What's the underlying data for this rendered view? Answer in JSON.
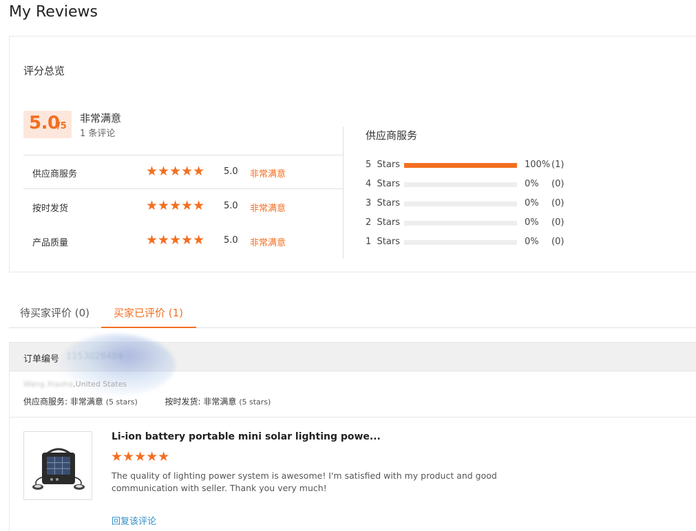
{
  "page": {
    "title": "My Reviews"
  },
  "summary": {
    "heading": "评分总览",
    "score": "5.0",
    "score_denominator": "/5",
    "overall_label": "非常满意",
    "review_count": "1 条评论",
    "dimensions": [
      {
        "name": "供应商服务",
        "stars": "★★★★★",
        "score": "5.0",
        "label": "非常满意"
      },
      {
        "name": "按时发货",
        "stars": "★★★★★",
        "score": "5.0",
        "label": "非常满意"
      },
      {
        "name": "产品质量",
        "stars": "★★★★★",
        "score": "5.0",
        "label": "非常满意"
      }
    ],
    "distribution": {
      "title": "供应商服务",
      "rows": [
        {
          "label": "5  Stars",
          "fill": 1.0,
          "percent": "100%",
          "count": "(1)"
        },
        {
          "label": "4  Stars",
          "fill": 0.0,
          "percent": "0%",
          "count": "(0)"
        },
        {
          "label": "3  Stars",
          "fill": 0.0,
          "percent": "0%",
          "count": "(0)"
        },
        {
          "label": "2  Stars",
          "fill": 0.0,
          "percent": "0%",
          "count": "(0)"
        },
        {
          "label": "1  Stars",
          "fill": 0.0,
          "percent": "0%",
          "count": "(0)"
        }
      ]
    }
  },
  "tabs": {
    "pending": "待买家评价 (0)",
    "done": "买家已评价 (1)"
  },
  "order": {
    "number_label": "订单编号",
    "number_value": "1153028484",
    "buyer_name": "Wang Xiaoha",
    "buyer_location": ",United States",
    "rating_service_label": "供应商服务: ",
    "rating_service_value": "非常满意",
    "rating_service_stars": "(5 stars)",
    "rating_shipping_label": "按时发货: ",
    "rating_shipping_value": "非常满意",
    "rating_shipping_stars": "(5 stars)"
  },
  "review": {
    "product_title": "Li-ion battery portable mini solar lighting powe...",
    "stars": "★★★★★",
    "text": "The quality of lighting power system is awesome! I'm satisfied with my product and good communication with seller. Thank you very much!",
    "reply_link": "回复该评论"
  },
  "colors": {
    "accent": "#f36f21",
    "link": "#2f8fc9",
    "track": "#eeeeee"
  }
}
